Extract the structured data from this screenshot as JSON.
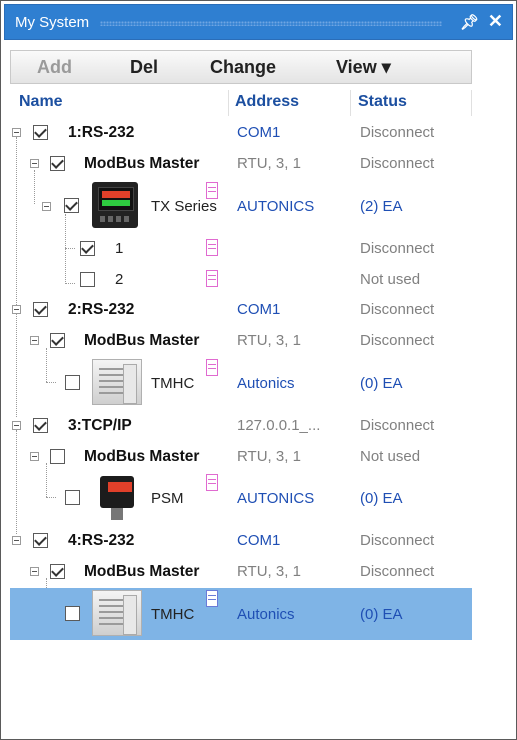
{
  "window": {
    "title": "My System",
    "pin_icon": "pin-icon",
    "close_icon": "close-icon"
  },
  "toolbar": {
    "add": "Add",
    "del": "Del",
    "change": "Change",
    "view": "View ▾"
  },
  "columns": {
    "name": "Name",
    "address": "Address",
    "status": "Status"
  },
  "rows": [
    {
      "name": "1:RS-232",
      "address": "COM1",
      "status": "Disconnect"
    },
    {
      "name": "ModBus Master",
      "address": "RTU, 3, 1",
      "status": "Disconnect"
    },
    {
      "name": "TX Series",
      "address": "AUTONICS",
      "status": "(2) EA"
    },
    {
      "name": "1",
      "address": "",
      "status": "Disconnect"
    },
    {
      "name": "2",
      "address": "",
      "status": "Not used"
    },
    {
      "name": "2:RS-232",
      "address": "COM1",
      "status": "Disconnect"
    },
    {
      "name": "ModBus Master",
      "address": "RTU, 3, 1",
      "status": "Disconnect"
    },
    {
      "name": "TMHC",
      "address": "Autonics",
      "status": "(0) EA"
    },
    {
      "name": "3:TCP/IP",
      "address": "127.0.0.1_...",
      "status": "Disconnect"
    },
    {
      "name": "ModBus Master",
      "address": "RTU, 3, 1",
      "status": "Not used"
    },
    {
      "name": "PSM",
      "address": "AUTONICS",
      "status": "(0) EA"
    },
    {
      "name": "4:RS-232",
      "address": "COM1",
      "status": "Disconnect"
    },
    {
      "name": "ModBus Master",
      "address": "RTU, 3, 1",
      "status": "Disconnect"
    },
    {
      "name": "TMHC",
      "address": "Autonics",
      "status": "(0) EA"
    }
  ],
  "colors": {
    "title_bar": "#2f7fd1",
    "selection": "#7fb4e6",
    "header_text": "#1c4fa0",
    "link_text": "#1f4fb4"
  }
}
